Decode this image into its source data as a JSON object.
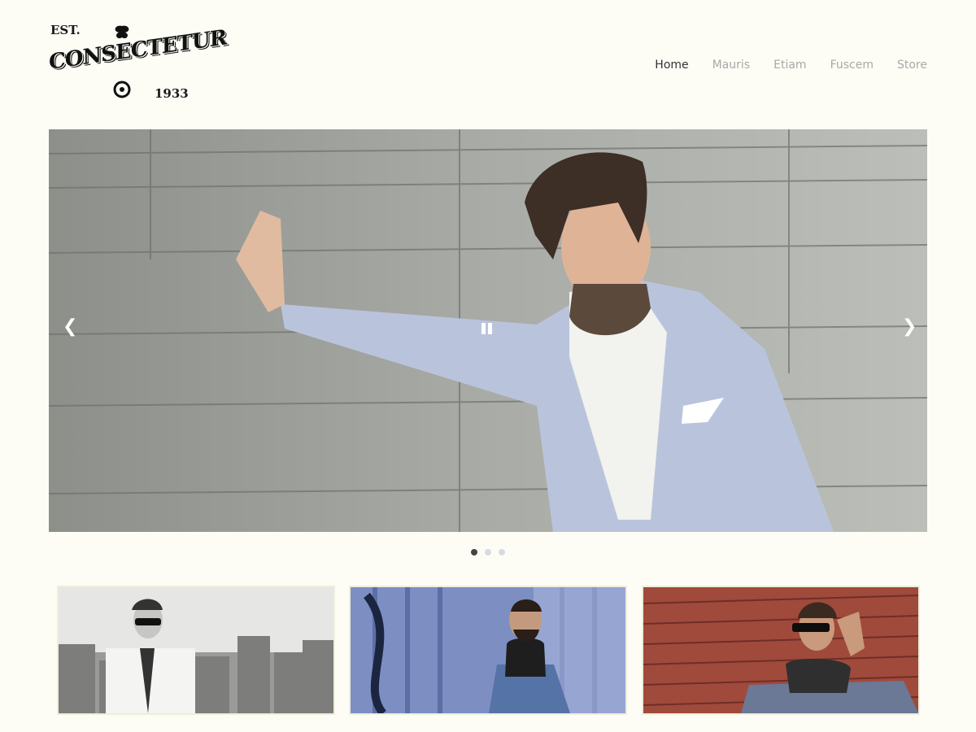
{
  "logo": {
    "est": "EST.",
    "name": "CONSECTETUR",
    "year": "1933"
  },
  "nav": {
    "items": [
      "Home",
      "Mauris",
      "Etiam",
      "Fuscem",
      "Store"
    ],
    "active": "Home"
  },
  "slider": {
    "prev_icon": "chevron-left-icon",
    "next_icon": "chevron-right-icon",
    "pause_icon": "pause-icon",
    "slide_count": 3,
    "active_slide": 1
  },
  "thumbnails": [
    {
      "name": "thumbnail-grayscale-city"
    },
    {
      "name": "thumbnail-graffiti-wall"
    },
    {
      "name": "thumbnail-brick-wall"
    }
  ],
  "colors": {
    "background": "#fdfdf6",
    "nav_active": "#333333",
    "nav_inactive": "#a8a8a8",
    "dot_active": "#444444",
    "dot_inactive": "#d6dde0"
  }
}
